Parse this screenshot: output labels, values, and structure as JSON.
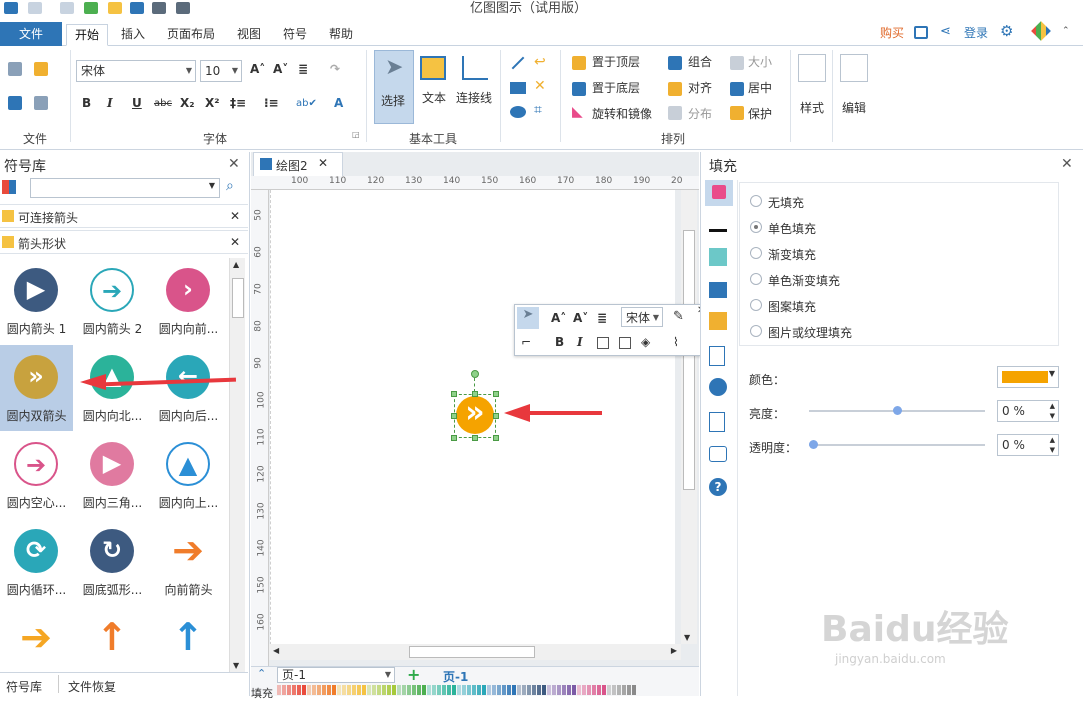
{
  "app": {
    "title": "亿图图示（试用版）"
  },
  "menu": {
    "file": "文件",
    "tabs": [
      "开始",
      "插入",
      "页面布局",
      "视图",
      "符号",
      "帮助"
    ],
    "buy": "购买",
    "login": "登录"
  },
  "ribbon": {
    "groups": {
      "file": "文件",
      "font": "字体",
      "basic_tools": "基本工具",
      "arrange": "排列"
    },
    "font_name": "宋体",
    "font_size": "10",
    "tools": {
      "select": "选择",
      "text": "文本",
      "connector": "连接线"
    },
    "arrange": {
      "bring_front": "置于顶层",
      "send_back": "置于底层",
      "rotate": "旋转和镜像",
      "group": "组合",
      "align": "对齐",
      "distribute": "分布",
      "size": "大小",
      "center": "居中",
      "protect": "保护"
    },
    "style": "样式",
    "edit": "编辑"
  },
  "symbols": {
    "title": "符号库",
    "search_placeholder": "",
    "categories": [
      "可连接箭头",
      "箭头形状"
    ],
    "shapes": [
      {
        "label": "圆内箭头 1",
        "color": "#3d5a80",
        "glyph": "▶",
        "fg": "#ffffff"
      },
      {
        "label": "圆内箭头 2",
        "color": "#ffffff",
        "glyph": "➔",
        "fg": "#2aa7b8"
      },
      {
        "label": "圆内向前...",
        "color": "#d9548a",
        "glyph": "›",
        "fg": "#ffffff"
      },
      {
        "label": "圆内双箭头",
        "color": "#c8a23e",
        "glyph": "»",
        "fg": "#ffffff"
      },
      {
        "label": "圆内向北...",
        "color": "#2bb39a",
        "glyph": "▲",
        "fg": "#ffffff"
      },
      {
        "label": "圆内向后...",
        "color": "#2aa7b8",
        "glyph": "←",
        "fg": "#ffffff"
      },
      {
        "label": "圆内空心...",
        "color": "#ffffff",
        "glyph": "➔",
        "fg": "#d9548a"
      },
      {
        "label": "圆内三角...",
        "color": "#e07aa0",
        "glyph": "▶",
        "fg": "#ffffff"
      },
      {
        "label": "圆内向上...",
        "color": "#ffffff",
        "glyph": "▲",
        "fg": "#2b8fd6"
      },
      {
        "label": "圆内循环...",
        "color": "#2aa7b8",
        "glyph": "⟳",
        "fg": "#ffffff"
      },
      {
        "label": "圆底弧形...",
        "color": "#3d5a80",
        "glyph": "↻",
        "fg": "#ffffff"
      },
      {
        "label": "向前箭头",
        "color": "transparent",
        "glyph": "➔",
        "fg": "#f07c2a"
      },
      {
        "label": "",
        "color": "transparent",
        "glyph": "➔",
        "fg": "#f5a623"
      },
      {
        "label": "",
        "color": "transparent",
        "glyph": "↑",
        "fg": "#f07c2a"
      },
      {
        "label": "",
        "color": "transparent",
        "glyph": "↑",
        "fg": "#2b8fd6"
      }
    ],
    "footer_tabs": [
      "符号库",
      "文件恢复"
    ]
  },
  "document": {
    "tab": "绘图2",
    "ruler_h": [
      "100",
      "110",
      "120",
      "130",
      "140",
      "150",
      "160",
      "170",
      "180",
      "190",
      "20"
    ],
    "ruler_v": [
      "50",
      "60",
      "70",
      "80",
      "90",
      "100",
      "110",
      "120",
      "130",
      "140",
      "150",
      "160"
    ],
    "page_select": "页-1",
    "page_tab": "页-1",
    "fill_label": "填充",
    "floating_font": "宋体"
  },
  "fill_panel": {
    "title": "填充",
    "options": [
      "无填充",
      "单色填充",
      "渐变填充",
      "单色渐变填充",
      "图案填充",
      "图片或纹理填充"
    ],
    "selected_index": 1,
    "color_label": "颜色：",
    "color_value": "#f5a300",
    "brightness_label": "亮度：",
    "brightness_value": "0 %",
    "transparency_label": "透明度：",
    "transparency_value": "0 %"
  },
  "colors": {
    "accent": "#2e75b6",
    "selected_shape": "#f5a300",
    "arrow_marker": "#e8383d"
  },
  "watermark": {
    "logo": "Baidu经验",
    "url": "jingyan.baidu.com"
  }
}
